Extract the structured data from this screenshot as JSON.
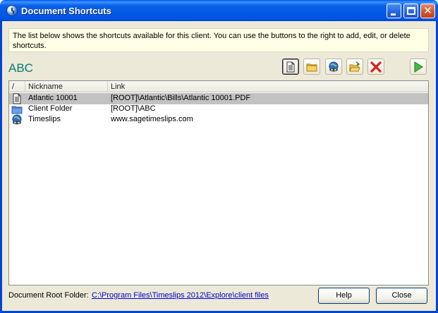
{
  "window": {
    "title": "Document Shortcuts"
  },
  "info_text": "The list below shows the shortcuts available for this client. You can use the buttons to the right to add, edit, or delete shortcuts.",
  "client_name": "ABC",
  "toolbar": {
    "icons": [
      "new-document-icon",
      "folder-icon",
      "web-link-icon",
      "open-folder-icon",
      "delete-icon",
      "run-icon"
    ]
  },
  "list": {
    "columns": [
      "/",
      "Nickname",
      "Link"
    ],
    "rows": [
      {
        "icon": "document-icon",
        "nickname": "Atlantic 10001",
        "link": "[ROOT]\\Atlantic\\Bills\\Atlantic 10001.PDF",
        "selected": true
      },
      {
        "icon": "folder-icon",
        "nickname": "Client Folder",
        "link": "[ROOT]\\ABC",
        "selected": false
      },
      {
        "icon": "web-icon",
        "nickname": "Timeslips",
        "link": "www.sagetimeslips.com",
        "selected": false
      }
    ]
  },
  "footer": {
    "root_label": "Document Root Folder:",
    "root_path": "C:\\Program Files\\Timeslips 2012\\Explore\\client files",
    "help_label": "Help",
    "close_label": "Close"
  }
}
